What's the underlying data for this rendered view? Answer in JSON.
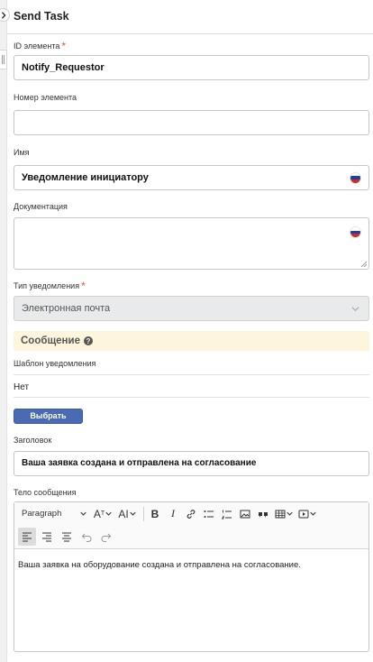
{
  "panel": {
    "title": "Send Task"
  },
  "fields": {
    "element_id": {
      "label": "ID элемента",
      "required_mark": "*",
      "value": "Notify_Requestor"
    },
    "element_number": {
      "label": "Номер элемента",
      "value": ""
    },
    "name": {
      "label": "Имя",
      "value": "Уведомление инициатору"
    },
    "documentation": {
      "label": "Документация",
      "value": ""
    },
    "notification_type": {
      "label": "Тип уведомления",
      "required_mark": "*",
      "value": "Электронная почта"
    }
  },
  "message_section": {
    "title": "Сообщение",
    "help_icon": "?",
    "template_label": "Шаблон уведомления",
    "template_value": "Нет",
    "select_button": "Выбрать",
    "subject_label": "Заголовок",
    "subject_value": "Ваша заявка создана и отправлена на согласование",
    "body_label": "Тело сообщения",
    "body_value": "Ваша заявка на оборудование создана и отправлена на согласование."
  },
  "editor_toolbar": {
    "paragraph": "Paragraph",
    "font_size": "A",
    "font_family": "AI",
    "bold": "B",
    "italic": "I",
    "icons": [
      "chevron-down-icon",
      "font-size-icon",
      "font-family-icon",
      "bold-icon",
      "italic-icon",
      "link-icon",
      "bulleted-list-icon",
      "numbered-list-icon",
      "image-icon",
      "quote-icon",
      "table-icon",
      "media-icon",
      "align-left-icon",
      "align-right-icon",
      "align-center-icon",
      "undo-icon",
      "redo-icon"
    ]
  },
  "colors": {
    "accent": "#4a6bb3",
    "required": "#e4572e",
    "banner": "#fdf5dc",
    "disabled": "#e9eaeb"
  }
}
